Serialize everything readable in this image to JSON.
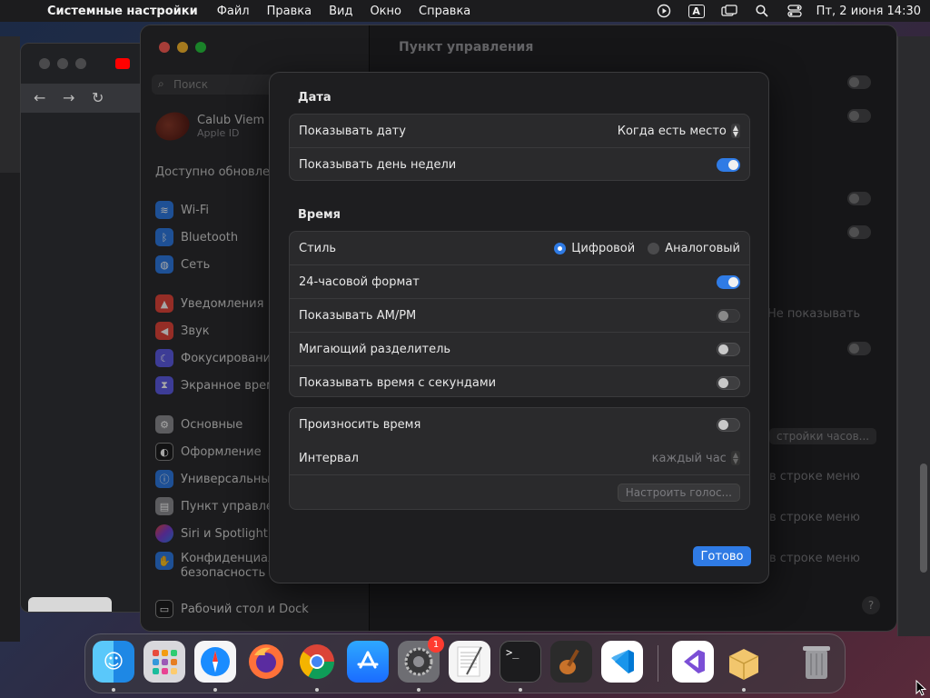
{
  "menubar": {
    "app_name": "Системные настройки",
    "items": [
      "Файл",
      "Правка",
      "Вид",
      "Окно",
      "Справка"
    ],
    "input_source": "A",
    "clock": "Пт, 2 июня  14:30"
  },
  "sidebar": {
    "search_placeholder": "Поиск",
    "account_name": "Calub Viem",
    "account_sub": "Apple ID",
    "updates_label": "Доступно обновлен",
    "items": [
      {
        "label": "Wi-Fi",
        "icon": "wifi-icon",
        "color": "#2f7be5"
      },
      {
        "label": "Bluetooth",
        "icon": "bluetooth-icon",
        "color": "#2f7be5"
      },
      {
        "label": "Сеть",
        "icon": "globe-icon",
        "color": "#2f7be5"
      },
      {
        "label": "Уведомления",
        "icon": "bell-icon",
        "color": "#e5463b"
      },
      {
        "label": "Звук",
        "icon": "speaker-icon",
        "color": "#e5463b"
      },
      {
        "label": "Фокусирование",
        "icon": "moon-icon",
        "color": "#5e5ce6"
      },
      {
        "label": "Экранное врем",
        "icon": "hourglass-icon",
        "color": "#5e5ce6"
      },
      {
        "label": "Основные",
        "icon": "gear-icon",
        "color": "#8e8e93"
      },
      {
        "label": "Оформление",
        "icon": "appearance-icon",
        "color": "#1c1c1e"
      },
      {
        "label": "Универсальный",
        "icon": "accessibility-icon",
        "color": "#2f7be5"
      },
      {
        "label": "Пункт управлен",
        "icon": "control-center-icon",
        "color": "#8e8e93"
      },
      {
        "label": "Siri и Spotlight",
        "icon": "siri-icon",
        "color": "#7d3fd4"
      },
      {
        "label": "Конфиденциаль безопасность",
        "icon": "hand-icon",
        "color": "#2f7be5"
      },
      {
        "label": "Рабочий стол и Dock",
        "icon": "desktop-icon",
        "color": "#1c1c1e"
      }
    ]
  },
  "main": {
    "title": "Пункт управления",
    "bg_labels": {
      "not_show": "Не показывать",
      "clock_settings": "стройки часов...",
      "in_menu_1": "в строке меню",
      "in_menu_2": "в строке меню",
      "in_menu_3": "в строке меню"
    }
  },
  "sheet": {
    "date_section": "Дата",
    "show_date_label": "Показывать дату",
    "show_date_value": "Когда есть место",
    "show_weekday_label": "Показывать день недели",
    "show_weekday_on": true,
    "time_section": "Время",
    "style_label": "Стиль",
    "style_digital": "Цифровой",
    "style_analog": "Аналоговый",
    "style_selected": "digital",
    "h24_label": "24-часовой формат",
    "h24_on": true,
    "ampm_label": "Показывать AM/PM",
    "ampm_on": false,
    "blink_label": "Мигающий разделитель",
    "blink_on": false,
    "seconds_label": "Показывать время с секундами",
    "seconds_on": false,
    "announce_label": "Произносить время",
    "announce_on": false,
    "interval_label": "Интервал",
    "interval_value": "каждый час",
    "voice_button": "Настроить голос...",
    "done_button": "Готово"
  },
  "dock": {
    "apps": [
      {
        "name": "finder-icon",
        "color": "#1e88e5"
      },
      {
        "name": "launchpad-icon",
        "color": "#e0e0e0"
      },
      {
        "name": "safari-icon",
        "color": "#1a73e8"
      },
      {
        "name": "firefox-icon",
        "color": "#ff7139"
      },
      {
        "name": "chrome-icon",
        "color": "#ffffff"
      },
      {
        "name": "app-store-icon",
        "color": "#1a8cff"
      },
      {
        "name": "system-settings-icon",
        "color": "#8e8e93"
      },
      {
        "name": "textedit-icon",
        "color": "#f5f5f5"
      },
      {
        "name": "terminal-icon",
        "color": "#1c1c1e"
      },
      {
        "name": "garageband-icon",
        "color": "#2b2b2b"
      },
      {
        "name": "vscode-icon",
        "color": "#ffffff"
      },
      {
        "name": "visual-studio-icon",
        "color": "#ffffff"
      },
      {
        "name": "installer-icon",
        "color": "#f2c66d"
      },
      {
        "name": "trash-icon",
        "color": "#8a8a8e"
      }
    ],
    "settings_badge": "1"
  }
}
